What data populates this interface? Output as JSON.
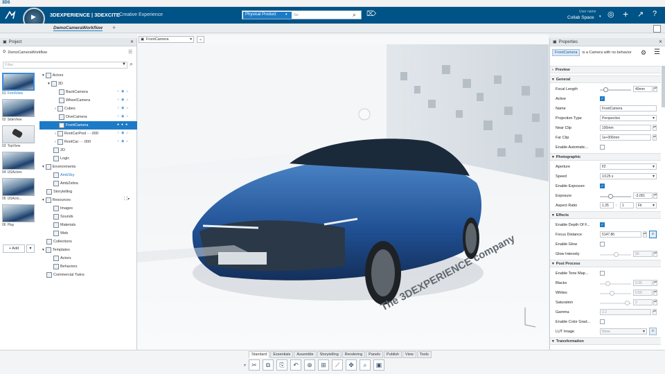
{
  "titlebar": {
    "logo": "3DS"
  },
  "topbar": {
    "brand": "3DEXPERIENCE | 3DEXCITE",
    "app_name": "Creative Experience",
    "compass_version": "V.R",
    "search_scope": "Physical Product",
    "search_placeholder": "Se",
    "user_label": "User name",
    "collab_space": "Collab Space"
  },
  "subbar": {
    "tab": "DemoCameraWorkflow",
    "add": "+"
  },
  "left": {
    "panel_title": "Project",
    "project_name": "DemoCameraWorkflow",
    "filter_placeholder": "Filter",
    "thumbs": [
      {
        "num": "01",
        "label": "FrontView"
      },
      {
        "num": "02",
        "label": "SideView"
      },
      {
        "num": "03",
        "label": "TopView"
      },
      {
        "num": "04",
        "label": "USActors"
      },
      {
        "num": "05",
        "label": "USActo..."
      },
      {
        "num": "06",
        "label": "Play"
      }
    ],
    "add_label": "+ Add",
    "tree": [
      {
        "label": "Actors",
        "indent": 0
      },
      {
        "label": "3D",
        "indent": 1
      },
      {
        "label": "BackCamera",
        "indent": 2
      },
      {
        "label": "WheelCamera",
        "indent": 2
      },
      {
        "label": "Cubes",
        "indent": 2
      },
      {
        "label": "DiveCamera",
        "indent": 2
      },
      {
        "label": "FrontCamera",
        "indent": 2
      },
      {
        "label": "RootCarPool ···.000",
        "indent": 2
      },
      {
        "label": "RootCar ···.000",
        "indent": 2
      },
      {
        "label": "2D",
        "indent": 1
      },
      {
        "label": "Logic",
        "indent": 1
      },
      {
        "label": "Environments",
        "indent": 0
      },
      {
        "label": "AmbSky",
        "indent": 1
      },
      {
        "label": "AmbZebra",
        "indent": 1
      },
      {
        "label": "Storytelling",
        "indent": 0
      },
      {
        "label": "Resources",
        "indent": 0
      },
      {
        "label": "Images",
        "indent": 1
      },
      {
        "label": "Sounds",
        "indent": 1
      },
      {
        "label": "Materials",
        "indent": 1
      },
      {
        "label": "Web",
        "indent": 1
      },
      {
        "label": "Collections",
        "indent": 0
      },
      {
        "label": "Templates",
        "indent": 0
      },
      {
        "label": "Actors",
        "indent": 1
      },
      {
        "label": "Behaviors",
        "indent": 1
      },
      {
        "label": "Commercial Twins",
        "indent": 0
      }
    ]
  },
  "viewport": {
    "camera_select": "FrontCamera",
    "floor_text": "The 3DEXPERIENCE company"
  },
  "right": {
    "panel_title": "Properties",
    "object_chip": "FrontCamera",
    "object_desc": "is a Camera with no behavior",
    "sections": {
      "preview": "Preview",
      "general": "General",
      "photographic": "Photographic",
      "effects": "Effects",
      "post": "Post Process",
      "transform": "Transformation"
    },
    "general": {
      "focal_length": "Focal Length",
      "focal_value": "40mm",
      "active": "Active",
      "name": "Name",
      "name_value": "FrontCamera",
      "projection": "Projection Type",
      "projection_value": "Perspective",
      "near": "Near Clip",
      "near_value": "100mm",
      "far": "Far Clip",
      "far_value": "1e+006mm",
      "auto": "Enable Automatic..."
    },
    "photographic": {
      "aperture": "Aperture",
      "aperture_value": "f/2",
      "speed": "Speed",
      "speed_value": "1/125 s",
      "exposure_enable": "Enable Exposure",
      "exposure": "Exposure",
      "exposure_value": "-3.051",
      "aspect": "Aspect Ratio",
      "aspect_a": "1.35",
      "aspect_sep": ":",
      "aspect_b": "1",
      "aspect_unit": "Fit"
    },
    "effects": {
      "dof": "Enable Depth Of F...",
      "focus": "Focus Distance",
      "focus_value": "5147.86",
      "glow": "Enable Glow",
      "glow_int": "Glow Intensity",
      "glow_value": "50"
    },
    "post": {
      "tonemap": "Enable Tone Map...",
      "blacks": "Blacks",
      "blacks_value": "0.35",
      "whites": "Whites",
      "whites_value": "0.55",
      "saturation": "Saturation",
      "saturation_value": "2",
      "gamma": "Gamma",
      "gamma_value": "2.2",
      "color_grad": "Enable Color Grad...",
      "lut": "LUT Image",
      "lut_value": "None"
    }
  },
  "bottom": {
    "tabs": [
      "Standard",
      "Essentials",
      "Assemble",
      "Storytelling",
      "Rendering",
      "Panels",
      "Publish",
      "View",
      "Tools"
    ]
  }
}
